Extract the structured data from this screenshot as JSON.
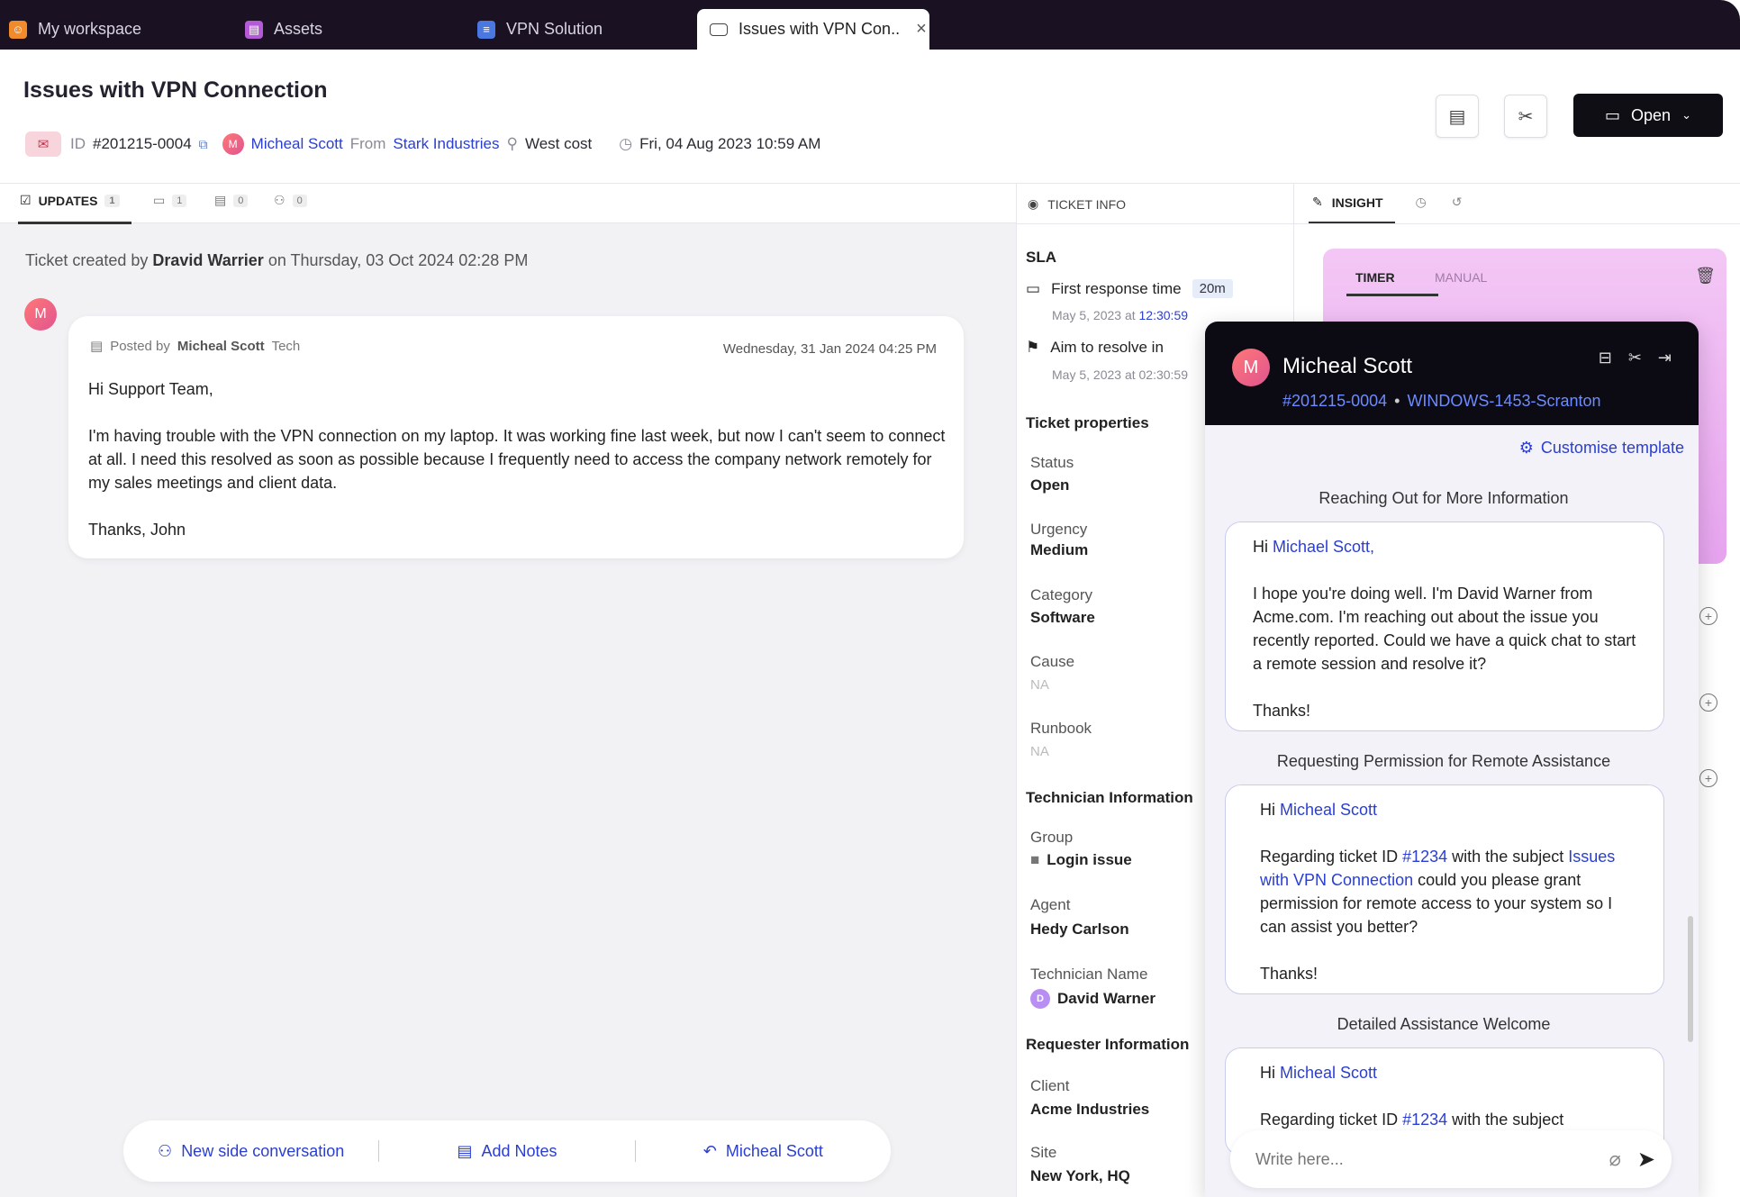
{
  "tabs": [
    {
      "label": "My workspace"
    },
    {
      "label": "Assets"
    },
    {
      "label": "VPN Solution"
    },
    {
      "label": "Issues with VPN Con.."
    }
  ],
  "ticket": {
    "title": "Issues with VPN Connection",
    "id_label": "ID",
    "id": "#201215-0004",
    "requester": "Micheal Scott",
    "from_label": "From",
    "company": "Stark Industries",
    "location": "West cost",
    "datetime": "Fri, 04 Aug 2023 10:59 AM",
    "status_button": "Open"
  },
  "updates": {
    "tabs": [
      {
        "label": "UPDATES",
        "count": "1"
      },
      {
        "label": "",
        "count": "1"
      },
      {
        "label": "",
        "count": "0"
      },
      {
        "label": "",
        "count": "0"
      }
    ],
    "created_prefix": "Ticket created by",
    "created_by": "Dravid Warrier",
    "created_suffix": "on Thursday, 03 Oct 2024 02:28 PM",
    "post": {
      "avatar": "M",
      "posted_by_label": "Posted by",
      "author": "Micheal Scott",
      "role": "Tech",
      "date": "Wednesday, 31 Jan 2024 04:25 PM",
      "greeting": "Hi Support Team,",
      "body": "I'm having trouble with the VPN connection on my laptop. It was working fine last week, but now I can't seem to connect at all. I need this resolved as soon as possible because I frequently need to access the company network remotely for my sales meetings and client data.",
      "sign_off": "Thanks, John"
    },
    "actions": {
      "side_conversation": "New side conversation",
      "add_notes": "Add  Notes",
      "reply_to": "Micheal Scott"
    }
  },
  "ticket_info": {
    "header": "TICKET INFO",
    "sla_title": "SLA",
    "first_response_label": "First response time",
    "first_response_value": "20m",
    "first_response_date": "May 5, 2023 at",
    "first_response_time": "12:30:59",
    "resolve_label": "Aim to resolve in",
    "resolve_date": "May 5, 2023 at 02:30:59",
    "properties_title": "Ticket properties",
    "status_label": "Status",
    "status_value": "Open",
    "urgency_label": "Urgency",
    "urgency_value": "Medium",
    "category_label": "Category",
    "category_value": "Software",
    "cause_label": "Cause",
    "cause_value": "NA",
    "runbook_label": "Runbook",
    "runbook_value": "NA",
    "tech_title": "Technician Information",
    "group_label": "Group",
    "group_value": "Login issue",
    "agent_label": "Agent",
    "agent_value": "Hedy Carlson",
    "tech_name_label": "Technician Name",
    "tech_name_avatar": "D",
    "tech_name_value": "David Warner",
    "requester_title": "Requester Information",
    "client_label": "Client",
    "client_value": "Acme Industries",
    "site_label": "Site",
    "site_value": "New York, HQ"
  },
  "insight": {
    "header": "INSIGHT",
    "timer_tab": "TIMER",
    "manual_tab": "MANUAL"
  },
  "chat": {
    "avatar": "M",
    "name": "Micheal Scott",
    "ticket_id": "#201215-0004",
    "device": "WINDOWS-1453-Scranton",
    "customise": "Customise template",
    "templates": [
      {
        "title": "Reaching Out for More Information",
        "greeting_prefix": "Hi",
        "greeting_name": "Michael Scott,",
        "body": "I hope you're doing well. I'm David Warner from Acme.com. I'm reaching out about the issue you recently reported. Could we have a quick chat to start a remote session and resolve it?",
        "sign_off": "Thanks!"
      },
      {
        "title": "Requesting Permission for Remote Assistance",
        "greeting_prefix": "Hi",
        "greeting_name": "Micheal Scott",
        "body_prefix": "Regarding ticket ID",
        "ticket_ref": "#1234",
        "body_mid": "with the subject",
        "subject": "Issues with VPN Connection",
        "body_suffix": "could you please grant permission for remote access to your system so I can assist you better?",
        "sign_off": "Thanks!"
      },
      {
        "title": "Detailed Assistance Welcome",
        "greeting_prefix": "Hi",
        "greeting_name": "Micheal Scott",
        "body_prefix": "Regarding ticket ID",
        "ticket_ref": "#1234",
        "body_mid": "with the subject"
      }
    ],
    "input_placeholder": "Write here..."
  },
  "colors": {
    "accent": "#2a3ed1",
    "topbar": "#1a1222",
    "chat_header": "#0c0a12",
    "timer_card": "#e6a3ee"
  }
}
